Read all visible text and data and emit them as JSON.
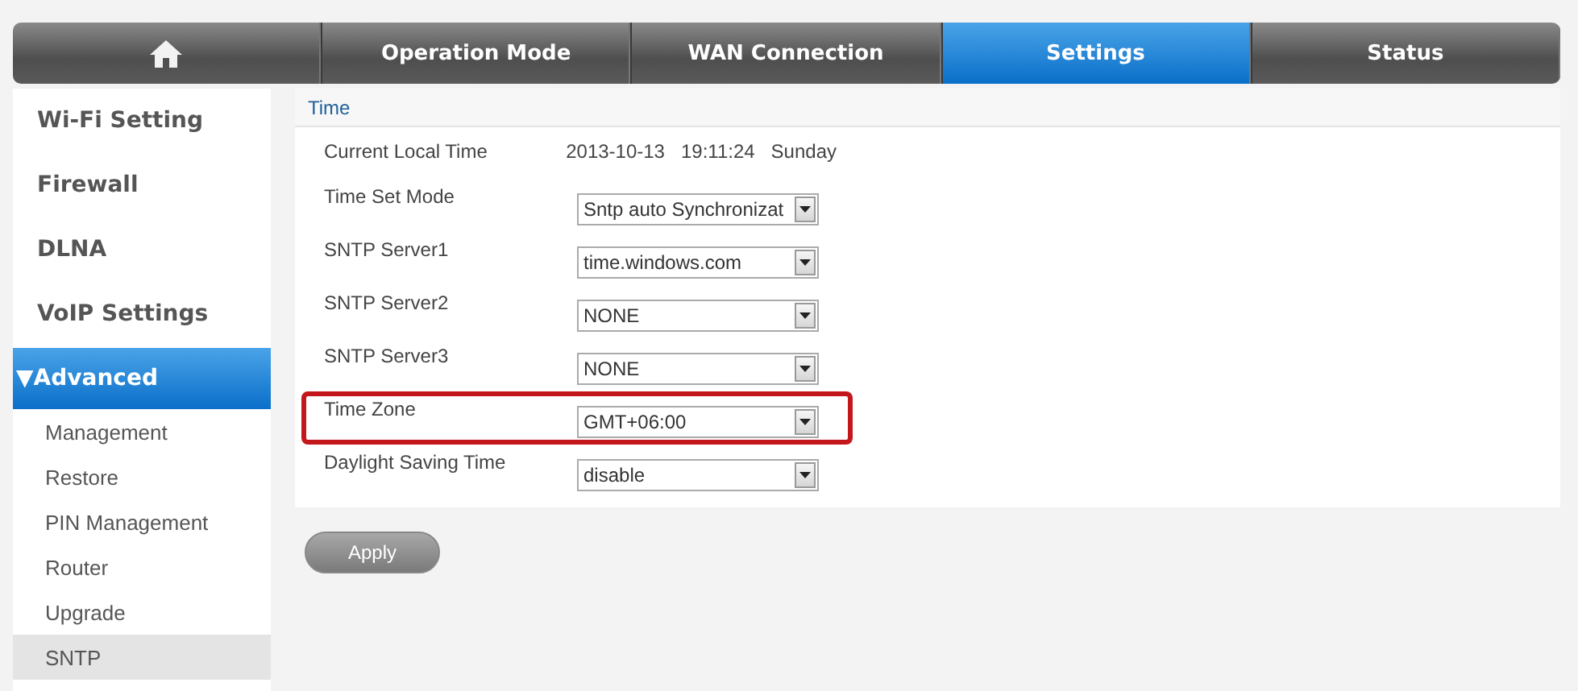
{
  "nav": {
    "tabs": [
      {
        "kind": "home",
        "selected": false
      },
      {
        "kind": "text",
        "label": "Operation Mode",
        "selected": false
      },
      {
        "kind": "text",
        "label": "WAN Connection",
        "selected": false
      },
      {
        "kind": "text",
        "label": "Settings",
        "selected": true
      },
      {
        "kind": "text",
        "label": "Status",
        "selected": false
      }
    ]
  },
  "sidebar": {
    "items": [
      {
        "label": "Wi-Fi Setting",
        "selected": false
      },
      {
        "label": "Firewall",
        "selected": false
      },
      {
        "label": "DLNA",
        "selected": false
      },
      {
        "label": "VoIP Settings",
        "selected": false
      },
      {
        "label": "Advanced",
        "selected": true,
        "expanded": true,
        "expander": "▼",
        "children": [
          {
            "label": "Management",
            "selected": false
          },
          {
            "label": "Restore",
            "selected": false
          },
          {
            "label": "PIN Management",
            "selected": false
          },
          {
            "label": "Router",
            "selected": false
          },
          {
            "label": "Upgrade",
            "selected": false
          },
          {
            "label": "SNTP",
            "selected": true
          }
        ]
      }
    ]
  },
  "panel": {
    "title": "Time",
    "rows": [
      {
        "kind": "text",
        "label": "Current Local Time",
        "value": "2013-10-13   19:11:24   Sunday",
        "highlighted": false
      },
      {
        "kind": "select",
        "label": "Time Set Mode",
        "value": "Sntp auto Synchronizat",
        "highlighted": false
      },
      {
        "kind": "select",
        "label": "SNTP Server1",
        "value": "time.windows.com",
        "highlighted": false
      },
      {
        "kind": "select",
        "label": "SNTP Server2",
        "value": "NONE",
        "highlighted": false
      },
      {
        "kind": "select",
        "label": "SNTP Server3",
        "value": "NONE",
        "highlighted": false
      },
      {
        "kind": "select",
        "label": "Time Zone",
        "value": "GMT+06:00",
        "highlighted": true
      },
      {
        "kind": "select",
        "label": "Daylight Saving Time",
        "value": "disable",
        "highlighted": false
      }
    ]
  },
  "apply_button": "Apply"
}
